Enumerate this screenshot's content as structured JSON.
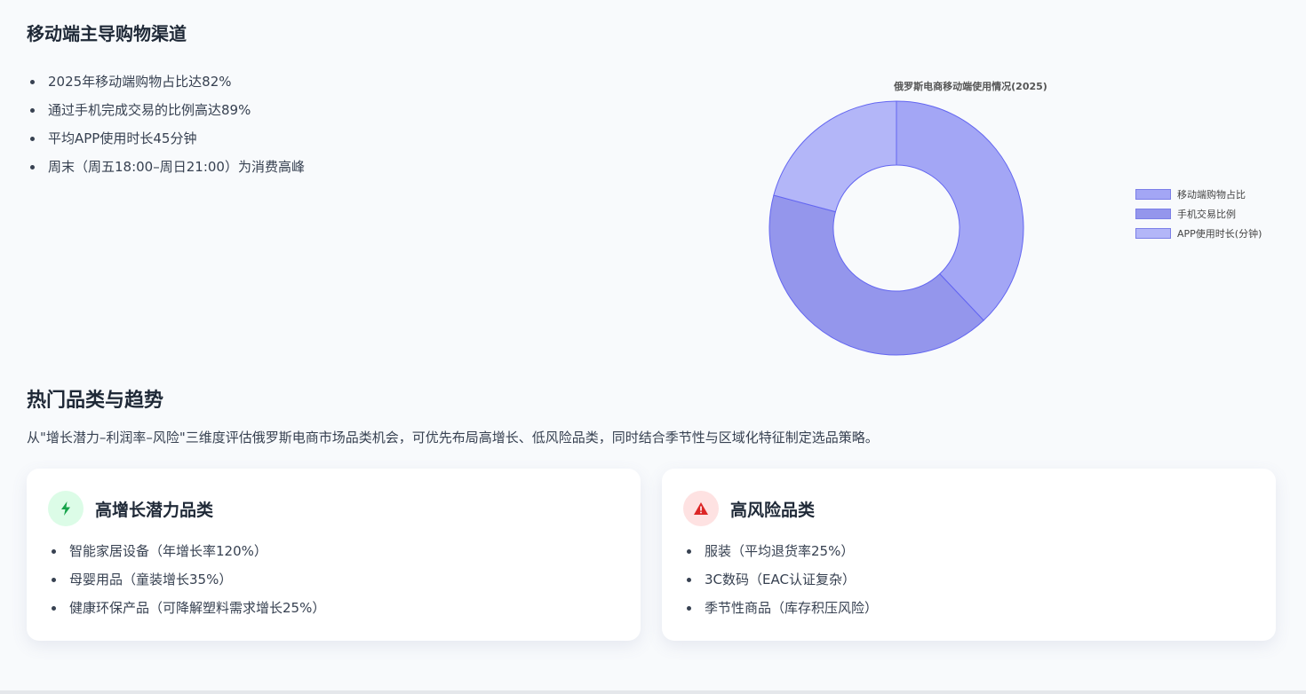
{
  "mobile_section": {
    "title": "移动端主导购物渠道",
    "bullets": [
      "2025年移动端购物占比达82%",
      "通过手机完成交易的比例高达89%",
      "平均APP使用时长45分钟",
      "周末（周五18:00–周日21:00）为消费高峰"
    ]
  },
  "chart_data": {
    "type": "pie",
    "title": "俄罗斯电商移动端使用情况(2025)",
    "labels": [
      "移动端购物占比",
      "手机交易比例",
      "APP使用时长(分钟)"
    ],
    "values": [
      82,
      89,
      45
    ],
    "colors": [
      "#a3a6f5",
      "#9496ec",
      "#b3b6f8"
    ],
    "border_color": "#6366f1",
    "donut": true,
    "legend_position": "right"
  },
  "categories_section": {
    "title": "热门品类与趋势",
    "intro": "从\"增长潜力–利润率–风险\"三维度评估俄罗斯电商市场品类机会，可优先布局高增长、低风险品类，同时结合季节性与区域化特征制定选品策略。"
  },
  "growth_card": {
    "icon": "lightning-bolt-icon",
    "title": "高增长潜力品类",
    "accent": "#16a34a",
    "items": [
      "智能家居设备（年增长率120%）",
      "母婴用品（童装增长35%）",
      "健康环保产品（可降解塑料需求增长25%）"
    ]
  },
  "risk_card": {
    "icon": "warning-triangle-icon",
    "title": "高风险品类",
    "accent": "#dc2626",
    "items": [
      "服装（平均退货率25%）",
      "3C数码（EAC认证复杂）",
      "季节性商品（库存积压风险）"
    ]
  }
}
